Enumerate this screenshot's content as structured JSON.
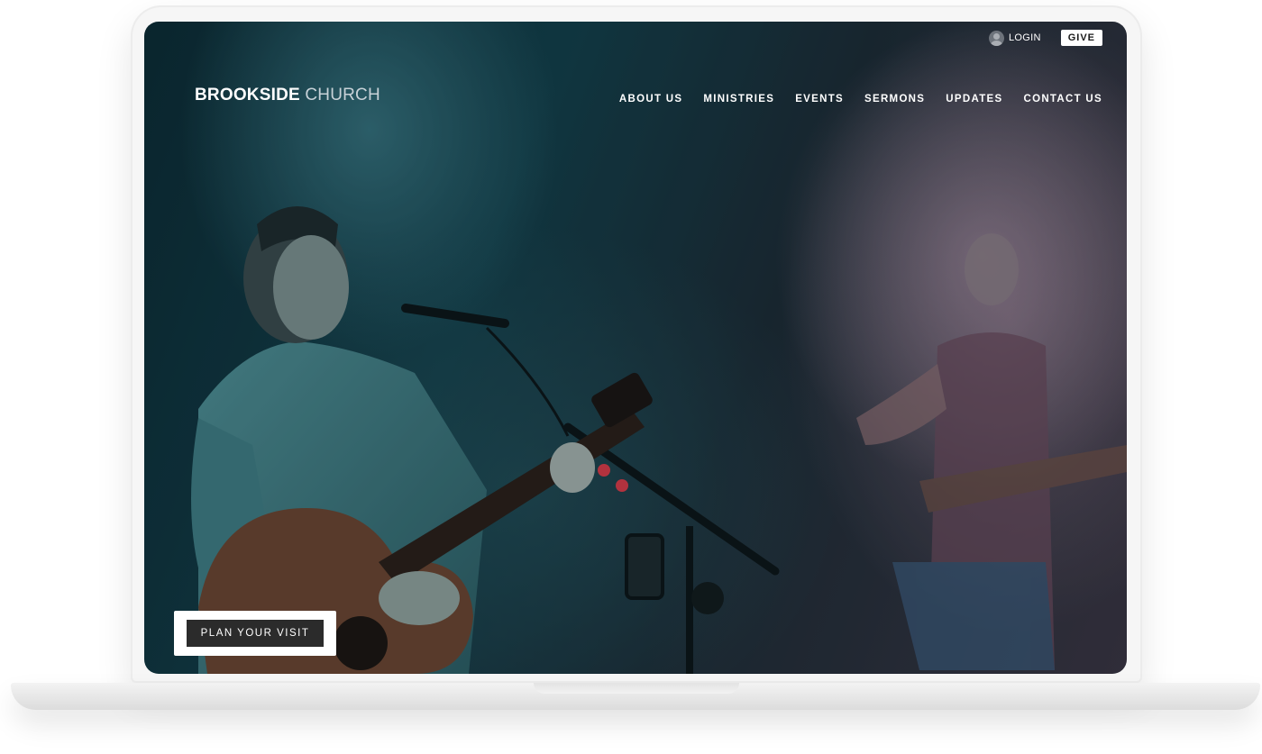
{
  "utility": {
    "login_label": "LOGIN",
    "give_label": "GIVE"
  },
  "header": {
    "logo_primary": "BROOKSIDE",
    "logo_secondary": "CHURCH"
  },
  "nav": {
    "items": [
      "ABOUT US",
      "MINISTRIES",
      "EVENTS",
      "SERMONS",
      "UPDATES",
      "CONTACT US"
    ]
  },
  "hero": {
    "cta_label": "PLAN YOUR VISIT"
  },
  "icons": {
    "login": "user-avatar-icon"
  },
  "colors": {
    "cta_bg": "#2b2b2b",
    "give_bg": "#ffffff",
    "screen_tint": "#123e49"
  }
}
